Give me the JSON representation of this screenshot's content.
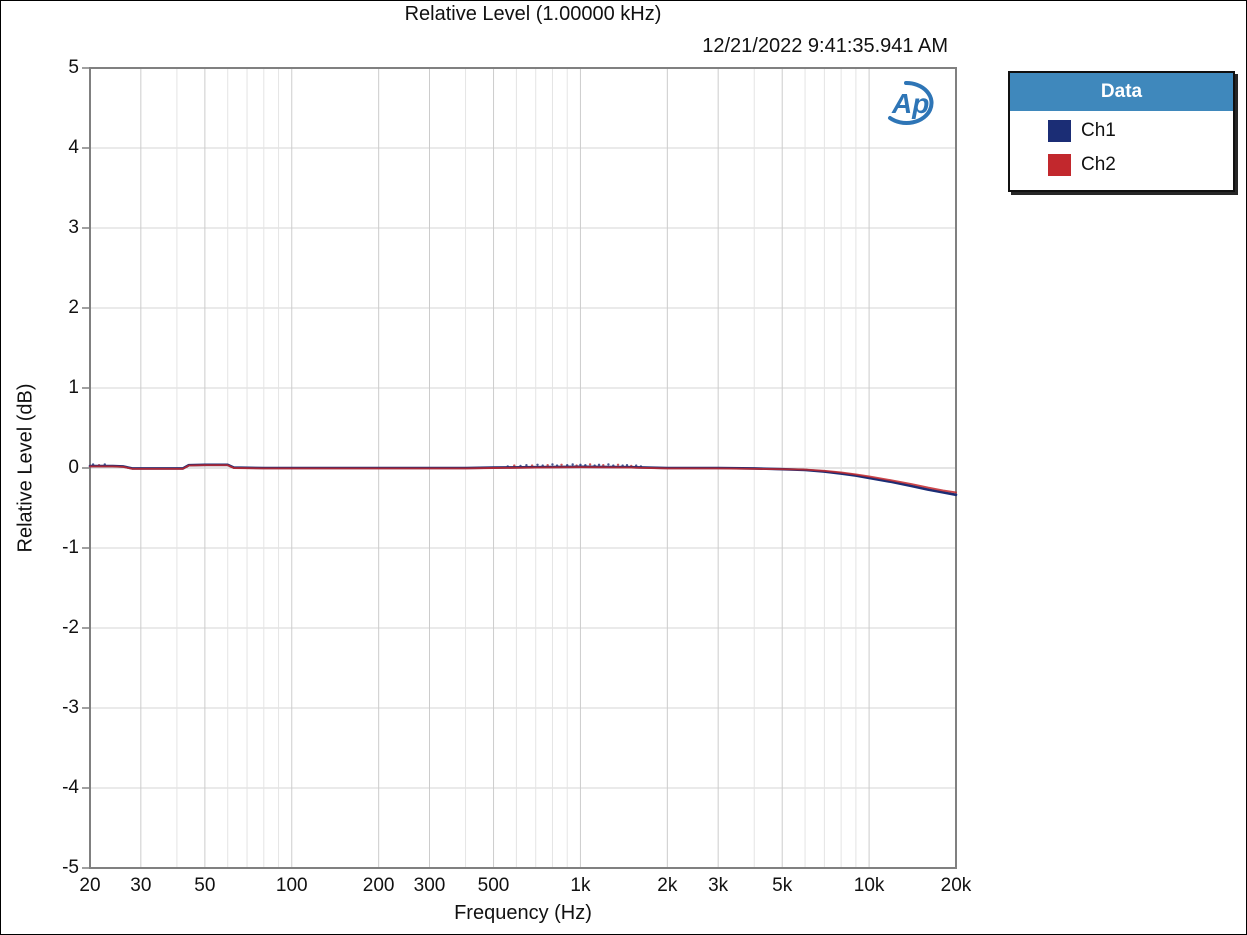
{
  "page": {
    "title": "Relative Level (1.00000 kHz)",
    "timestamp": "12/21/2022 9:41:35.941 AM"
  },
  "logo": {
    "name": "audio-precision-logo",
    "text": "Ap"
  },
  "legend": {
    "header": "Data",
    "items": [
      {
        "label": "Ch1",
        "color": "#1B2D75"
      },
      {
        "label": "Ch2",
        "color": "#C2282D"
      }
    ]
  },
  "colors": {
    "grid_major": "#CCCCCC",
    "grid_minor": "#E4E4E4",
    "grid_horizontal": "#D6D6D6",
    "zero_line": "#C8C8C8",
    "frame": "#808080",
    "tick": "#808080",
    "text": "#111111",
    "legend_header_bg": "#3F88BC",
    "logo_blue": "#2E75B6"
  },
  "chart_data": {
    "type": "line",
    "title": "Relative Level (1.00000 kHz)",
    "xlabel": "Frequency (Hz)",
    "ylabel": "Relative Level (dB)",
    "x_scale": "log",
    "xlim": [
      20,
      20000
    ],
    "ylim": [
      -5,
      5
    ],
    "grid": true,
    "legend_position": "outside-right",
    "y_ticks": [
      5,
      4,
      3,
      2,
      1,
      0,
      -1,
      -2,
      -3,
      -4,
      -5
    ],
    "x_ticks": [
      {
        "value": 20,
        "label": "20"
      },
      {
        "value": 30,
        "label": "30"
      },
      {
        "value": 50,
        "label": "50"
      },
      {
        "value": 100,
        "label": "100"
      },
      {
        "value": 200,
        "label": "200"
      },
      {
        "value": 300,
        "label": "300"
      },
      {
        "value": 500,
        "label": "500"
      },
      {
        "value": 1000,
        "label": "1k"
      },
      {
        "value": 2000,
        "label": "2k"
      },
      {
        "value": 3000,
        "label": "3k"
      },
      {
        "value": 5000,
        "label": "5k"
      },
      {
        "value": 10000,
        "label": "10k"
      },
      {
        "value": 20000,
        "label": "20k"
      }
    ],
    "x_minor_gridlines": [
      40,
      60,
      70,
      80,
      90,
      400,
      600,
      700,
      800,
      900,
      4000,
      6000,
      7000,
      8000,
      9000
    ],
    "series": [
      {
        "name": "Ch1",
        "color": "#1B2D75",
        "points": [
          [
            20,
            0.025
          ],
          [
            24,
            0.025
          ],
          [
            26,
            0.02
          ],
          [
            28,
            -0.005
          ],
          [
            35,
            -0.005
          ],
          [
            42,
            -0.005
          ],
          [
            44,
            0.035
          ],
          [
            50,
            0.04
          ],
          [
            60,
            0.04
          ],
          [
            63,
            0.005
          ],
          [
            80,
            0.0
          ],
          [
            100,
            0.0
          ],
          [
            150,
            0.0
          ],
          [
            200,
            0.0
          ],
          [
            300,
            0.0
          ],
          [
            400,
            0.0
          ],
          [
            500,
            0.005
          ],
          [
            700,
            0.01
          ],
          [
            1000,
            0.015
          ],
          [
            1500,
            0.01
          ],
          [
            2000,
            0.0
          ],
          [
            3000,
            0.0
          ],
          [
            4000,
            -0.005
          ],
          [
            5000,
            -0.015
          ],
          [
            6000,
            -0.025
          ],
          [
            7000,
            -0.045
          ],
          [
            8000,
            -0.07
          ],
          [
            9000,
            -0.095
          ],
          [
            10000,
            -0.125
          ],
          [
            12000,
            -0.175
          ],
          [
            14000,
            -0.225
          ],
          [
            16000,
            -0.27
          ],
          [
            18000,
            -0.305
          ],
          [
            20000,
            -0.335
          ]
        ]
      },
      {
        "name": "Ch2",
        "color": "#C2282D",
        "points": [
          [
            20,
            0.02
          ],
          [
            24,
            0.02
          ],
          [
            26,
            0.015
          ],
          [
            28,
            -0.01
          ],
          [
            35,
            -0.01
          ],
          [
            42,
            -0.01
          ],
          [
            44,
            0.03
          ],
          [
            50,
            0.035
          ],
          [
            60,
            0.035
          ],
          [
            63,
            0.0
          ],
          [
            80,
            -0.005
          ],
          [
            100,
            -0.005
          ],
          [
            150,
            -0.005
          ],
          [
            200,
            -0.005
          ],
          [
            300,
            -0.005
          ],
          [
            400,
            -0.005
          ],
          [
            500,
            0.0
          ],
          [
            700,
            0.005
          ],
          [
            1000,
            0.01
          ],
          [
            1500,
            0.005
          ],
          [
            2000,
            -0.005
          ],
          [
            3000,
            -0.005
          ],
          [
            4000,
            -0.01
          ],
          [
            5000,
            -0.015
          ],
          [
            6000,
            -0.02
          ],
          [
            7000,
            -0.035
          ],
          [
            8000,
            -0.055
          ],
          [
            9000,
            -0.08
          ],
          [
            10000,
            -0.105
          ],
          [
            12000,
            -0.155
          ],
          [
            14000,
            -0.2
          ],
          [
            16000,
            -0.245
          ],
          [
            18000,
            -0.28
          ],
          [
            20000,
            -0.305
          ]
        ]
      }
    ],
    "noise_dots": {
      "description": "measurement jitter speckle near 0 dB between ~550 Hz and 1.6 kHz (channel 1=Ch1 color, 2=Ch2 color)",
      "points": [
        [
          20.5,
          0.045,
          1
        ],
        [
          21.5,
          0.035,
          2
        ],
        [
          22.5,
          0.045,
          1
        ],
        [
          560,
          0.02,
          1
        ],
        [
          590,
          0.03,
          2
        ],
        [
          620,
          0.025,
          1
        ],
        [
          650,
          0.035,
          1
        ],
        [
          680,
          0.03,
          2
        ],
        [
          710,
          0.04,
          1
        ],
        [
          740,
          0.03,
          1
        ],
        [
          770,
          0.035,
          2
        ],
        [
          800,
          0.045,
          1
        ],
        [
          830,
          0.03,
          1
        ],
        [
          860,
          0.04,
          2
        ],
        [
          900,
          0.035,
          1
        ],
        [
          940,
          0.045,
          1
        ],
        [
          970,
          0.03,
          2
        ],
        [
          1000,
          0.04,
          1
        ],
        [
          1040,
          0.035,
          1
        ],
        [
          1080,
          0.045,
          2
        ],
        [
          1120,
          0.03,
          1
        ],
        [
          1160,
          0.04,
          1
        ],
        [
          1200,
          0.035,
          2
        ],
        [
          1250,
          0.045,
          1
        ],
        [
          1300,
          0.03,
          1
        ],
        [
          1350,
          0.04,
          2
        ],
        [
          1400,
          0.03,
          1
        ],
        [
          1450,
          0.035,
          1
        ],
        [
          1500,
          0.025,
          2
        ],
        [
          1560,
          0.03,
          1
        ],
        [
          1620,
          0.02,
          1
        ]
      ]
    }
  }
}
